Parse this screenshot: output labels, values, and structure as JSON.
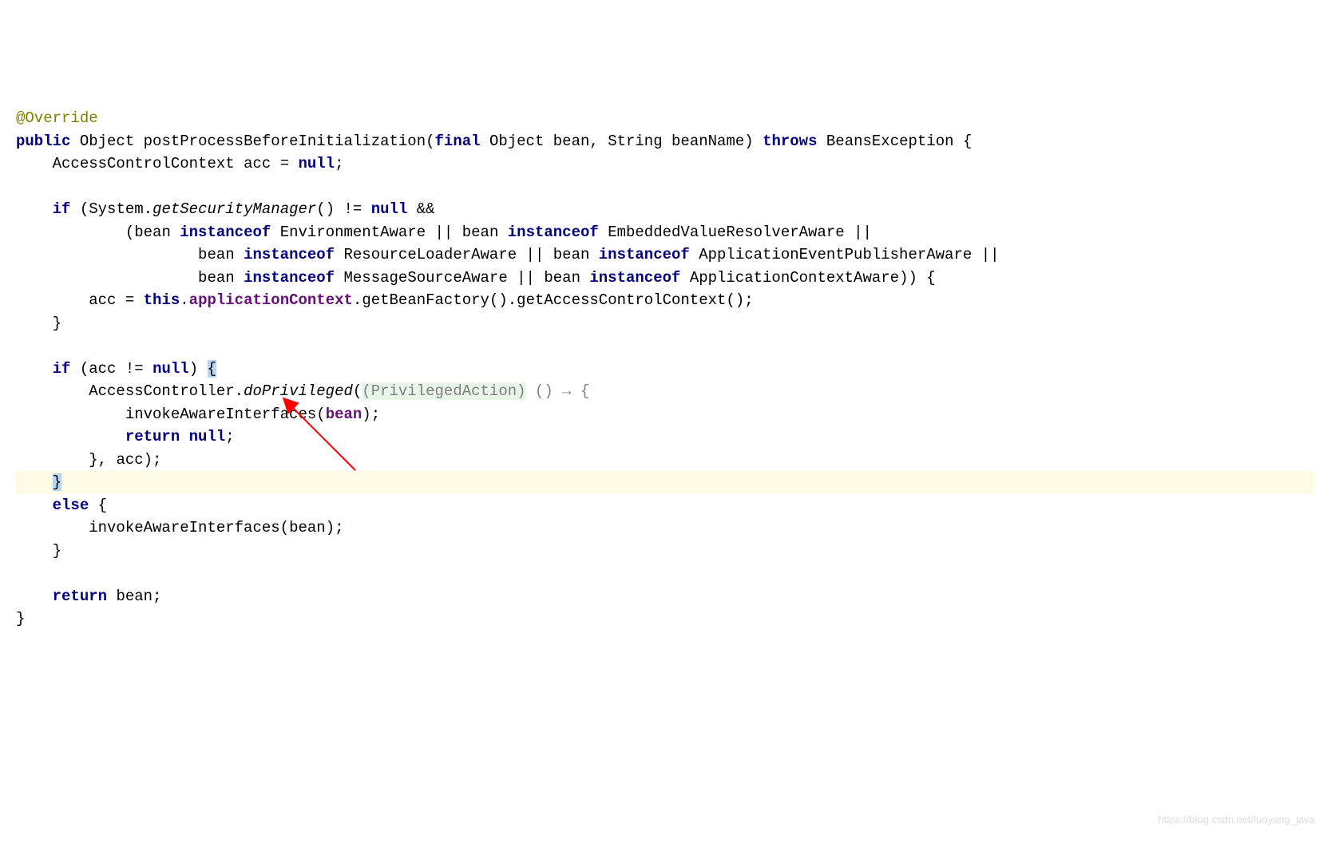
{
  "code": {
    "annotation": "@Override",
    "keywords": {
      "public": "public",
      "final": "final",
      "throws": "throws",
      "null": "null",
      "if": "if",
      "instanceof": "instanceof",
      "this": "this",
      "return": "return",
      "else": "else"
    },
    "types": {
      "Object": "Object",
      "String": "String",
      "BeansException": "BeansException",
      "AccessControlContext": "AccessControlContext",
      "System": "System",
      "EnvironmentAware": "EnvironmentAware",
      "EmbeddedValueResolverAware": "EmbeddedValueResolverAware",
      "ResourceLoaderAware": "ResourceLoaderAware",
      "ApplicationEventPublisherAware": "ApplicationEventPublisherAware",
      "MessageSourceAware": "MessageSourceAware",
      "ApplicationContextAware": "ApplicationContextAware",
      "AccessController": "AccessController",
      "PrivilegedAction": "(PrivilegedAction)"
    },
    "identifiers": {
      "postProcessBeforeInitialization": "postProcessBeforeInitialization",
      "bean": "bean",
      "beanName": "beanName",
      "acc": "acc",
      "getSecurityManager": "getSecurityManager",
      "applicationContext": "applicationContext",
      "getBeanFactory": "getBeanFactory",
      "getAccessControlContext": "getAccessControlContext",
      "doPrivileged": "doPrivileged",
      "invokeAwareInterfaces": "invokeAwareInterfaces"
    },
    "symbols": {
      "openBrace": "{",
      "closeBrace": "}",
      "openParen": "(",
      "closeParen": ")",
      "semicolon": ";",
      "comma": ",",
      "equals": "=",
      "notEquals": "!=",
      "and": "&&",
      "or": "||",
      "dot": ".",
      "arrow": " () → {"
    }
  },
  "watermark": "https://blog.csdn.net/luoyang_java"
}
